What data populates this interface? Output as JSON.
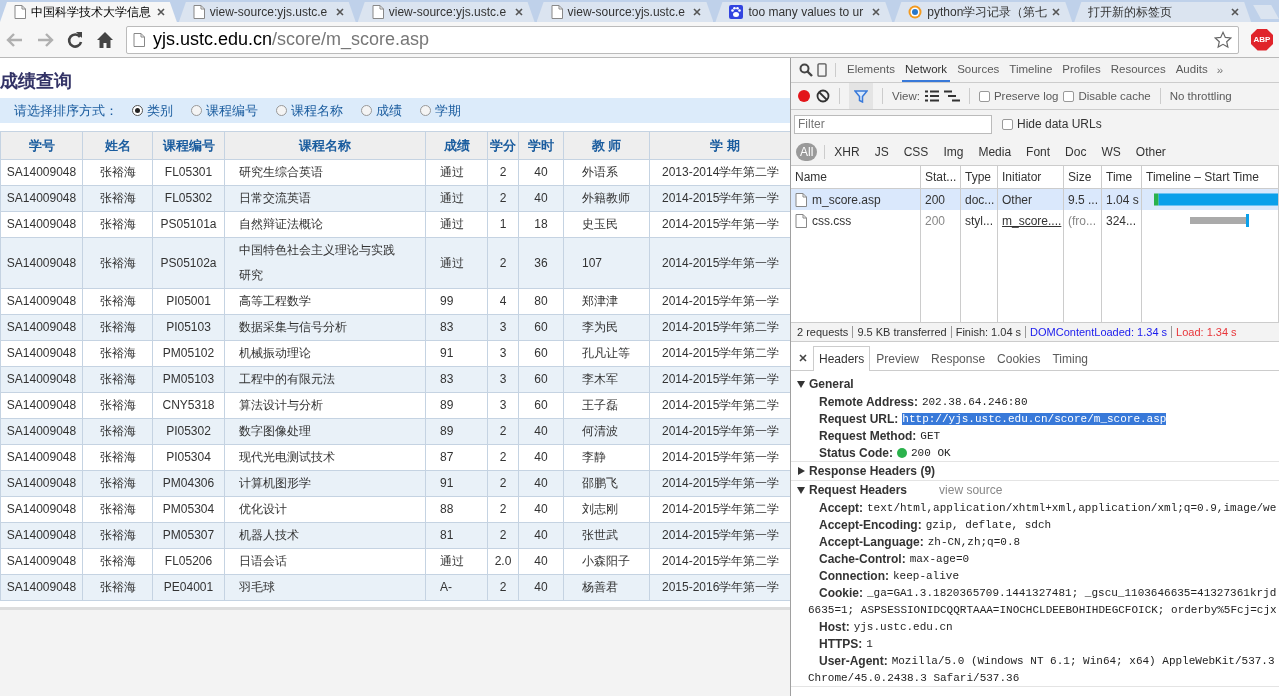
{
  "browser": {
    "tabs": [
      {
        "title": "中国科学技术大学信息",
        "kind": "page",
        "selected": true
      },
      {
        "title": "view-source:yjs.ustc.e",
        "kind": "page",
        "selected": false
      },
      {
        "title": "view-source:yjs.ustc.e",
        "kind": "page",
        "selected": false
      },
      {
        "title": "view-source:yjs.ustc.e",
        "kind": "page",
        "selected": false
      },
      {
        "title": "too many values to ur",
        "kind": "paw",
        "selected": false
      },
      {
        "title": "python学习记录（第七",
        "kind": "ring",
        "selected": false
      },
      {
        "title": "打开新的标签页",
        "kind": "blank",
        "selected": false
      }
    ],
    "forward_disabled": true,
    "address": {
      "host": "yjs.ustc.edu.cn",
      "path": "/score/m_score.asp"
    },
    "extension_badge": "ABP"
  },
  "page": {
    "title": "成绩查询",
    "sort_label": "请选择排序方式：",
    "sort_options": [
      {
        "label": "类别",
        "selected": true
      },
      {
        "label": "课程编号",
        "selected": false
      },
      {
        "label": "课程名称",
        "selected": false
      },
      {
        "label": "成绩",
        "selected": false
      },
      {
        "label": "学期",
        "selected": false
      }
    ],
    "columns": [
      "学号",
      "姓名",
      "课程编号",
      "课程名称",
      "成绩",
      "学分",
      "学时",
      "教 师",
      "学 期"
    ],
    "rows": [
      [
        "SA14009048",
        "张裕海",
        "FL05301",
        "研究生综合英语",
        "通过",
        "2",
        "40",
        "外语系",
        "2013-2014学年第二学"
      ],
      [
        "SA14009048",
        "张裕海",
        "FL05302",
        "日常交流英语",
        "通过",
        "2",
        "40",
        "外籍教师",
        "2014-2015学年第一学"
      ],
      [
        "SA14009048",
        "张裕海",
        "PS05101a",
        "自然辩证法概论",
        "通过",
        "1",
        "18",
        "史玉民",
        "2014-2015学年第一学"
      ],
      [
        "SA14009048",
        "张裕海",
        "PS05102a",
        "中国特色社会主义理论与实践研究",
        "通过",
        "2",
        "36",
        "107",
        "2014-2015学年第一学"
      ],
      [
        "SA14009048",
        "张裕海",
        "PI05001",
        "高等工程数学",
        "99",
        "4",
        "80",
        "郑津津",
        "2014-2015学年第一学"
      ],
      [
        "SA14009048",
        "张裕海",
        "PI05103",
        "数据采集与信号分析",
        "83",
        "3",
        "60",
        "李为民",
        "2014-2015学年第二学"
      ],
      [
        "SA14009048",
        "张裕海",
        "PM05102",
        "机械振动理论",
        "91",
        "3",
        "60",
        "孔凡让等",
        "2014-2015学年第二学"
      ],
      [
        "SA14009048",
        "张裕海",
        "PM05103",
        "工程中的有限元法",
        "83",
        "3",
        "60",
        "李木军",
        "2014-2015学年第一学"
      ],
      [
        "SA14009048",
        "张裕海",
        "CNY5318",
        "算法设计与分析",
        "89",
        "3",
        "60",
        "王子磊",
        "2014-2015学年第二学"
      ],
      [
        "SA14009048",
        "张裕海",
        "PI05302",
        "数字图像处理",
        "89",
        "2",
        "40",
        "何清波",
        "2014-2015学年第一学"
      ],
      [
        "SA14009048",
        "张裕海",
        "PI05304",
        "现代光电测试技术",
        "87",
        "2",
        "40",
        "李静",
        "2014-2015学年第一学"
      ],
      [
        "SA14009048",
        "张裕海",
        "PM04306",
        "计算机图形学",
        "91",
        "2",
        "40",
        "邵鹏飞",
        "2014-2015学年第一学"
      ],
      [
        "SA14009048",
        "张裕海",
        "PM05304",
        "优化设计",
        "88",
        "2",
        "40",
        "刘志刚",
        "2014-2015学年第二学"
      ],
      [
        "SA14009048",
        "张裕海",
        "PM05307",
        "机器人技术",
        "81",
        "2",
        "40",
        "张世武",
        "2014-2015学年第一学"
      ],
      [
        "SA14009048",
        "张裕海",
        "FL05206",
        "日语会话",
        "通过",
        "2.0",
        "40",
        "小森阳子",
        "2014-2015学年第二学"
      ],
      [
        "SA14009048",
        "张裕海",
        "PE04001",
        "羽毛球",
        "A-",
        "2",
        "40",
        "杨善君",
        "2015-2016学年第一学"
      ]
    ]
  },
  "devtools": {
    "panel_tabs": [
      {
        "label": "Elements",
        "selected": false
      },
      {
        "label": "Network",
        "selected": true
      },
      {
        "label": "Sources",
        "selected": false
      },
      {
        "label": "Timeline",
        "selected": false
      },
      {
        "label": "Profiles",
        "selected": false
      },
      {
        "label": "Resources",
        "selected": false
      },
      {
        "label": "Audits",
        "selected": false
      }
    ],
    "more": "»",
    "filter_on": true,
    "view_label": "View:",
    "options": [
      {
        "label": "Preserve log",
        "checked": false
      },
      {
        "label": "Disable cache",
        "checked": false
      }
    ],
    "throttling": "No throttling",
    "filter": {
      "placeholder": "Filter"
    },
    "hide_data_urls": {
      "label": "Hide data URLs",
      "checked": false
    },
    "type_filters": [
      {
        "label": "All",
        "selected": true
      },
      {
        "label": "XHR",
        "selected": false
      },
      {
        "label": "JS",
        "selected": false
      },
      {
        "label": "CSS",
        "selected": false
      },
      {
        "label": "Img",
        "selected": false
      },
      {
        "label": "Media",
        "selected": false
      },
      {
        "label": "Font",
        "selected": false
      },
      {
        "label": "Doc",
        "selected": false
      },
      {
        "label": "WS",
        "selected": false
      },
      {
        "label": "Other",
        "selected": false
      }
    ],
    "columns": [
      "Name",
      "Stat...",
      "Type",
      "Initiator",
      "Size",
      "Time",
      "Timeline – Start Time"
    ],
    "requests": [
      {
        "name": "m_score.asp",
        "status": "200",
        "type": "doc...",
        "initiator": "Other",
        "initiator_link": false,
        "size": "9.5 ...",
        "time": "1.04 s",
        "from_cache": false,
        "selected": true
      },
      {
        "name": "css.css",
        "status": "200",
        "type": "styl...",
        "initiator": "m_score....",
        "initiator_link": true,
        "size": "(fro...",
        "time": "324...",
        "from_cache": true,
        "selected": false
      }
    ],
    "summary": [
      {
        "text": "2 requests",
        "color": "#333333"
      },
      {
        "text": "9.5 KB transferred",
        "color": "#333333"
      },
      {
        "text": "Finish: 1.04 s",
        "color": "#333333"
      },
      {
        "text": "DOMContentLoaded: 1.34 s",
        "color": "#1a1aed"
      },
      {
        "text": "Load: 1.34 s",
        "color": "#e8363a"
      }
    ],
    "detail_tabs": [
      {
        "label": "Headers",
        "selected": true
      },
      {
        "label": "Preview",
        "selected": false
      },
      {
        "label": "Response",
        "selected": false
      },
      {
        "label": "Cookies",
        "selected": false
      },
      {
        "label": "Timing",
        "selected": false
      }
    ],
    "sections": [
      {
        "title": "General",
        "expanded": true,
        "entries": [
          {
            "name": "Remote Address:",
            "value": "202.38.64.246:80",
            "kind": "plain",
            "highlighted": false
          },
          {
            "name": "Request URL:",
            "value": "http://yjs.ustc.edu.cn/score/m_score.asp",
            "kind": "plain",
            "highlighted": true
          },
          {
            "name": "Request Method:",
            "value": "GET",
            "kind": "plain",
            "highlighted": false
          },
          {
            "name": "Status Code:",
            "value": "200 OK",
            "kind": "status",
            "highlighted": false
          }
        ]
      },
      {
        "title": "Response Headers (9)",
        "expanded": false
      },
      {
        "title": "Request Headers",
        "expanded": true,
        "link": "view source",
        "entries": [
          {
            "name": "Accept:",
            "value": "text/html,application/xhtml+xml,application/xml;q=0.9,image/we",
            "kind": "plain",
            "highlighted": false
          },
          {
            "name": "Accept-Encoding:",
            "value": "gzip, deflate, sdch",
            "kind": "plain",
            "highlighted": false
          },
          {
            "name": "Accept-Language:",
            "value": "zh-CN,zh;q=0.8",
            "kind": "plain",
            "highlighted": false
          },
          {
            "name": "Cache-Control:",
            "value": "max-age=0",
            "kind": "plain",
            "highlighted": false
          },
          {
            "name": "Connection:",
            "value": "keep-alive",
            "kind": "plain",
            "highlighted": false
          },
          {
            "name": "Cookie:",
            "value": "_ga=GA1.3.1820365709.1441327481; _gscu_1103646635=41327361krjd",
            "continuation": "6635=1; ASPSESSIONIDCQQRTAAA=INOCHCLDEEBOHIHDEGCFOICK; orderby%5Fcj=cjx",
            "kind": "plain",
            "highlighted": false
          },
          {
            "name": "Host:",
            "value": "yjs.ustc.edu.cn",
            "kind": "plain",
            "highlighted": false
          },
          {
            "name": "HTTPS:",
            "value": "1",
            "kind": "plain",
            "highlighted": false
          },
          {
            "name": "User-Agent:",
            "value": "Mozilla/5.0 (Windows NT 6.1; Win64; x64) AppleWebKit/537.3",
            "continuation": "Chrome/45.0.2438.3 Safari/537.36",
            "kind": "plain",
            "highlighted": false
          }
        ]
      }
    ]
  }
}
